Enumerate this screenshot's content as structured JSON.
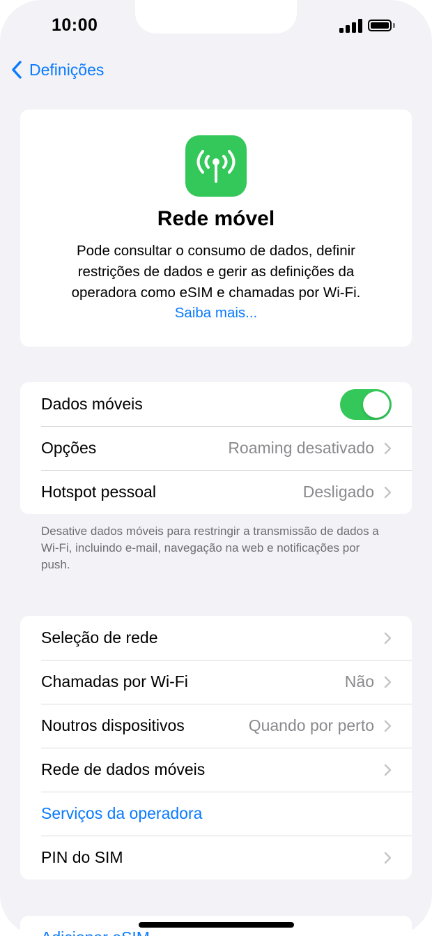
{
  "status_bar": {
    "time": "10:00"
  },
  "nav": {
    "back_label": "Definições"
  },
  "hero": {
    "icon": "antenna-signal-icon",
    "title": "Rede móvel",
    "description": "Pode consultar o consumo de dados, definir restrições de dados e gerir as definições da operadora como eSIM e chamadas por Wi-Fi.",
    "learn_more": "Saiba mais..."
  },
  "group1": {
    "mobile_data": {
      "label": "Dados móveis",
      "on": true
    },
    "options": {
      "label": "Opções",
      "value": "Roaming desativado"
    },
    "hotspot": {
      "label": "Hotspot pessoal",
      "value": "Desligado"
    },
    "footnote": "Desative dados móveis para restringir a transmissão de dados a Wi-Fi, incluindo e-mail, navegação na web e notificações por push."
  },
  "group2": {
    "network_selection": {
      "label": "Seleção de rede"
    },
    "wifi_calling": {
      "label": "Chamadas por Wi-Fi",
      "value": "Não"
    },
    "other_devices": {
      "label": "Noutros dispositivos",
      "value": "Quando por perto"
    },
    "mobile_data_network": {
      "label": "Rede de dados móveis"
    },
    "carrier_services": {
      "label": "Serviços da operadora"
    },
    "sim_pin": {
      "label": "PIN do SIM"
    }
  },
  "group3": {
    "add_esim": {
      "label": "Adicionar eSIM"
    }
  },
  "colors": {
    "accent": "#0a7aff",
    "green": "#34c759",
    "background": "#f2f2f7",
    "secondary_text": "#8a8a8e"
  }
}
